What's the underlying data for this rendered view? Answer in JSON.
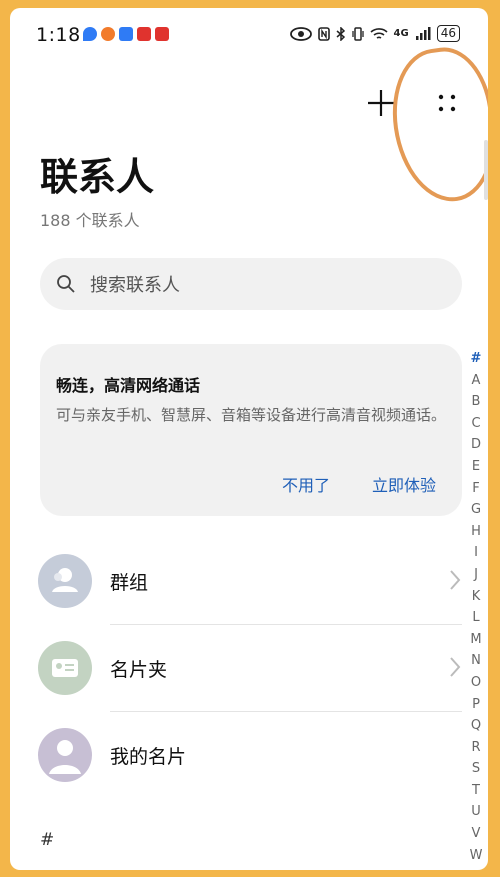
{
  "status_bar": {
    "time": "1:18",
    "battery": "46",
    "network": "4G"
  },
  "header": {
    "title": "联系人",
    "count": "188 个联系人"
  },
  "search": {
    "placeholder": "搜索联系人"
  },
  "promo": {
    "title": "畅连，高清网络通话",
    "description": "可与亲友手机、智慧屏、音箱等设备进行高清音视频通话。",
    "dismiss_label": "不用了",
    "try_label": "立即体验"
  },
  "list": {
    "items": [
      {
        "label": "群组"
      },
      {
        "label": "名片夹"
      },
      {
        "label": "我的名片"
      }
    ],
    "section_header": "#"
  },
  "index_bar": [
    "#",
    "A",
    "B",
    "C",
    "D",
    "E",
    "F",
    "G",
    "H",
    "I",
    "J",
    "K",
    "L",
    "M",
    "N",
    "O",
    "P",
    "Q",
    "R",
    "S",
    "T",
    "U",
    "V",
    "W"
  ],
  "colors": {
    "accent": "#1f5fb8",
    "frame": "#f3b64a",
    "annotation": "#e49a55"
  }
}
